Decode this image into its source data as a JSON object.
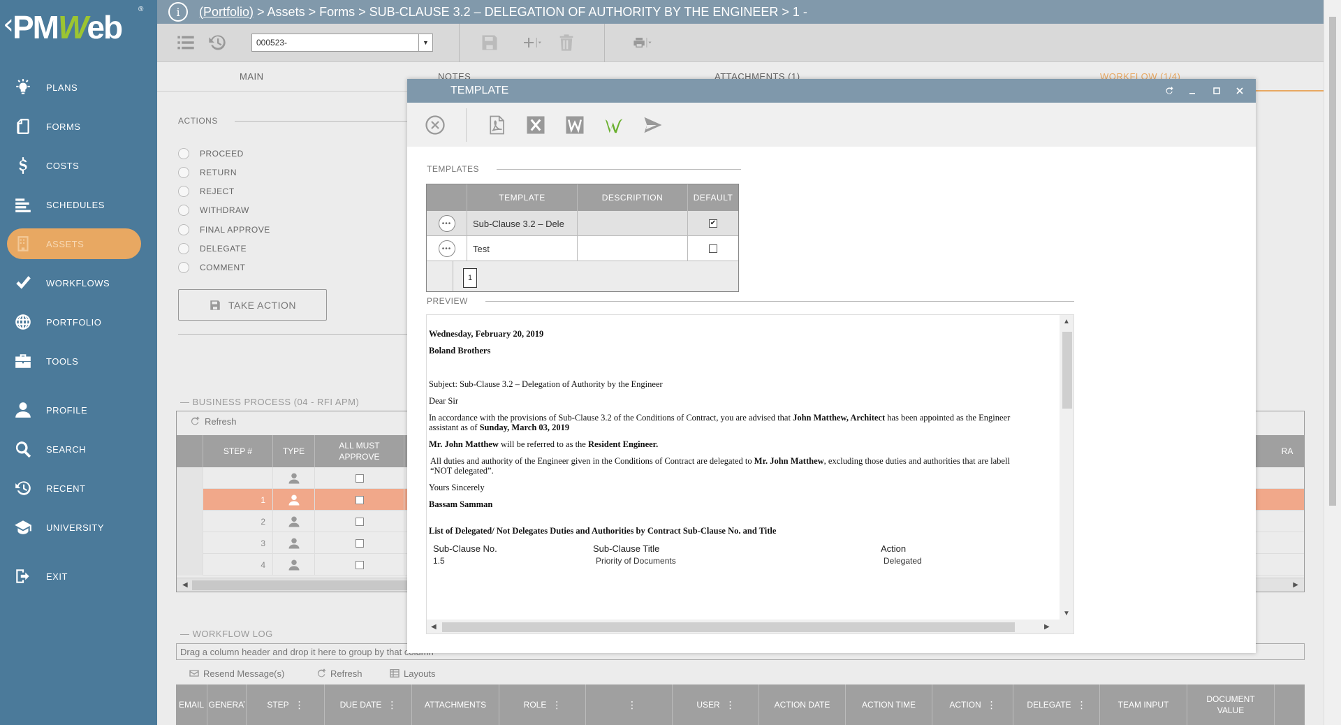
{
  "sidebar": {
    "logo": "PMWeb",
    "items": [
      {
        "label": "PLANS",
        "icon": "bulb-icon"
      },
      {
        "label": "FORMS",
        "icon": "form-icon"
      },
      {
        "label": "COSTS",
        "icon": "dollar-icon"
      },
      {
        "label": "SCHEDULES",
        "icon": "schedule-icon"
      },
      {
        "label": "ASSETS",
        "icon": "building-icon"
      },
      {
        "label": "WORKFLOWS",
        "icon": "check-icon"
      },
      {
        "label": "PORTFOLIO",
        "icon": "globe-icon"
      },
      {
        "label": "TOOLS",
        "icon": "toolbox-icon"
      },
      {
        "label": "PROFILE",
        "icon": "user-icon"
      },
      {
        "label": "SEARCH",
        "icon": "search-icon"
      },
      {
        "label": "RECENT",
        "icon": "history-icon"
      },
      {
        "label": "UNIVERSITY",
        "icon": "graduation-icon"
      },
      {
        "label": "EXIT",
        "icon": "exit-icon"
      }
    ]
  },
  "breadcrumb": {
    "portfolio": "(Portfolio)",
    "rest": " > Assets > Forms > SUB-CLAUSE 3.2 – DELEGATION OF AUTHORITY BY THE ENGINEER > 1 -"
  },
  "toolbar": {
    "record_value": "000523-"
  },
  "tabs": [
    {
      "label": "MAIN"
    },
    {
      "label": "NOTES"
    },
    {
      "label": "ATTACHMENTS (1)"
    },
    {
      "label": "WORKFLOW (1/4)"
    }
  ],
  "actions": {
    "title": "ACTIONS",
    "options": [
      "PROCEED",
      "RETURN",
      "REJECT",
      "WITHDRAW",
      "FINAL APPROVE",
      "DELEGATE",
      "COMMENT"
    ],
    "take_action": "TAKE ACTION"
  },
  "business_process": {
    "title": "BUSINESS PROCESS (04 - RFI APM)",
    "refresh": "Refresh",
    "columns": {
      "step": "STEP #",
      "type": "TYPE",
      "all_must_approve": "ALL MUST APPROVE",
      "ra": "RA"
    },
    "rows": [
      {
        "step": ""
      },
      {
        "step": "1"
      },
      {
        "step": "2"
      },
      {
        "step": "3"
      },
      {
        "step": "4"
      }
    ]
  },
  "workflow_log": {
    "title": "WORKFLOW LOG",
    "hint": "Drag a column header and drop it here to group by that column",
    "tools": {
      "resend": "Resend Message(s)",
      "refresh": "Refresh",
      "layouts": "Layouts"
    },
    "columns": [
      "EMAIL",
      "GENERAT",
      "STEP",
      "DUE DATE",
      "ATTACHMENTS",
      "ROLE",
      "",
      "USER",
      "ACTION DATE",
      "ACTION TIME",
      "ACTION",
      "DELEGATE",
      "TEAM INPUT",
      "DOCUMENT VALUE"
    ]
  },
  "modal": {
    "title": "TEMPLATE",
    "templates_title": "TEMPLATES",
    "grid_columns": {
      "template": "TEMPLATE",
      "description": "DESCRIPTION",
      "default": "DEFAULT"
    },
    "grid_rows": [
      {
        "template": "Sub-Clause 3.2 – Dele",
        "description": "",
        "default": true
      },
      {
        "template": "Test",
        "description": "",
        "default": false
      }
    ],
    "page": "1",
    "preview_title": "PREVIEW",
    "preview": {
      "date": "Wednesday, February 20, 2019",
      "company": "Boland Brothers",
      "subject": "Subject: Sub-Clause 3.2 – Delegation of Authority by the Engineer",
      "greeting": "Dear Sir",
      "p1_a": "In accordance with the provisions of Sub-Clause 3.2 of the Conditions of Contract, you are advised that ",
      "p1_name": "John Matthew, Architect",
      "p1_b": " has been appointed as the Engineer",
      "p1_c": "assistant as of ",
      "p1_date": "Sunday, March 03, 2019",
      "p2_name": "Mr. John Matthew",
      "p2_a": " will be referred to as the ",
      "p2_role": "Resident Engineer.",
      "p3_a": "All duties and authority of the Engineer given in the Conditions of Contract are delegated to ",
      "p3_name": "Mr. John Matthew",
      "p3_b": ", excluding those duties and authorities that are labell",
      "p3_c": "“NOT delegated”.",
      "closing": "Yours Sincerely",
      "signer": "Bassam Samman",
      "list_title": "List of Delegated/ Not Delegates Duties and Authorities by Contract Sub-Clause No. and Title",
      "table_headers": {
        "no": "Sub-Clause No.",
        "title": "Sub-Clause Title",
        "action": "Action"
      },
      "table_rows": [
        {
          "no": "1.5",
          "title": "Priority of Documents",
          "action": "Delegated"
        }
      ]
    }
  },
  "colors": {
    "sidebar": "#4b7a9a",
    "accent": "#e8a862",
    "titlebar": "#7f98ab",
    "header_gray": "#a0a0a0",
    "selected_row": "#f1a88a",
    "logo_green": "#9cc531"
  }
}
